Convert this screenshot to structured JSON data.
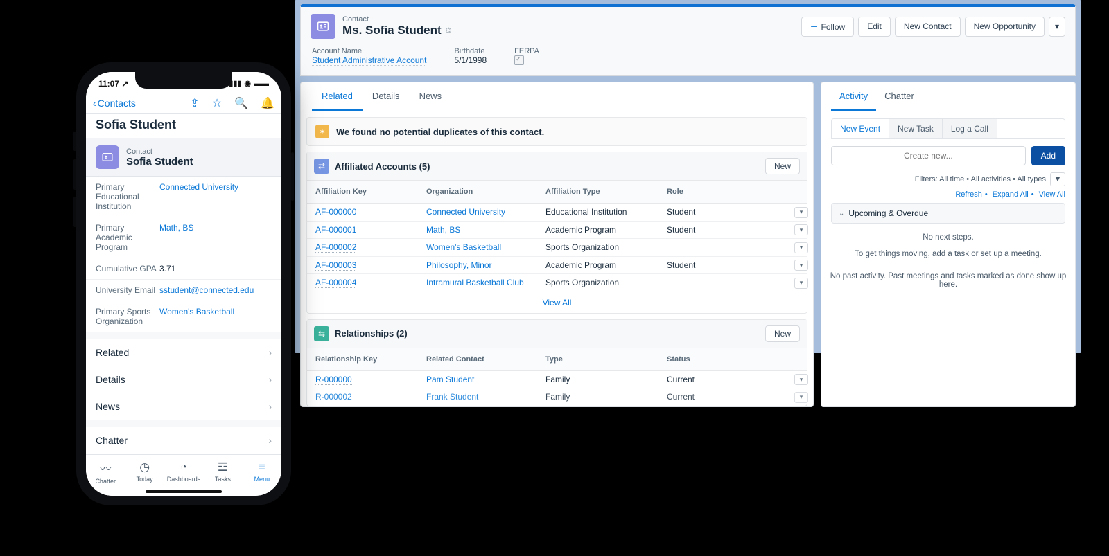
{
  "desktop": {
    "record_type": "Contact",
    "name": "Ms. Sofia Student",
    "actions": {
      "follow": "Follow",
      "edit": "Edit",
      "new_contact": "New Contact",
      "new_opportunity": "New Opportunity"
    },
    "fields": {
      "account_label": "Account Name",
      "account_value": "Student Administrative Account",
      "birth_label": "Birthdate",
      "birth_value": "5/1/1998",
      "ferpa_label": "FERPA"
    },
    "tabs": [
      "Related",
      "Details",
      "News"
    ],
    "duplicate_msg": "We found no potential duplicates of this contact.",
    "affiliated": {
      "title": "Affiliated Accounts (5)",
      "new": "New",
      "cols": [
        "Affiliation Key",
        "Organization",
        "Affiliation Type",
        "Role"
      ],
      "rows": [
        {
          "key": "AF-000000",
          "org": "Connected University",
          "type": "Educational Institution",
          "role": "Student"
        },
        {
          "key": "AF-000001",
          "org": "Math, BS",
          "type": "Academic Program",
          "role": "Student"
        },
        {
          "key": "AF-000002",
          "org": "Women's Basketball",
          "type": "Sports Organization",
          "role": ""
        },
        {
          "key": "AF-000003",
          "org": "Philosophy, Minor",
          "type": "Academic Program",
          "role": "Student"
        },
        {
          "key": "AF-000004",
          "org": "Intramural Basketball Club",
          "type": "Sports Organization",
          "role": ""
        }
      ],
      "view_all": "View All"
    },
    "relationships": {
      "title": "Relationships (2)",
      "new": "New",
      "cols": [
        "Relationship Key",
        "Related Contact",
        "Type",
        "Status"
      ],
      "rows": [
        {
          "key": "R-000000",
          "contact": "Pam Student",
          "type": "Family",
          "status": "Current"
        },
        {
          "key": "R-000002",
          "contact": "Frank Student",
          "type": "Family",
          "status": "Current"
        }
      ]
    }
  },
  "right": {
    "tabs": [
      "Activity",
      "Chatter"
    ],
    "sub_tabs": [
      "New Event",
      "New Task",
      "Log a Call"
    ],
    "create_placeholder": "Create new...",
    "add": "Add",
    "filter_text": "Filters: All time • All activities • All types",
    "refresh": "Refresh",
    "expand": "Expand All",
    "view_all": "View All",
    "upcoming": "Upcoming & Overdue",
    "empty1": "No next steps.",
    "empty2": "To get things moving, add a task or set up a meeting.",
    "past": "No past activity. Past meetings and tasks marked as done show up here."
  },
  "phone": {
    "time": "11:07",
    "back": "Contacts",
    "title": "Sofia Student",
    "card_type": "Contact",
    "card_name": "Sofia Student",
    "fields": [
      {
        "label": "Primary Educational Institution",
        "value": "Connected University",
        "link": true
      },
      {
        "label": "Primary Academic Program",
        "value": "Math, BS",
        "link": true
      },
      {
        "label": "Cumulative GPA",
        "value": "3.71",
        "link": false
      },
      {
        "label": "University Email",
        "value": "sstudent@connected.edu",
        "link": true
      },
      {
        "label": "Primary Sports Organization",
        "value": "Women's Basketball",
        "link": true
      }
    ],
    "sections": [
      "Related",
      "Details",
      "News",
      "Chatter"
    ],
    "tabbar": [
      {
        "icon": "⟿",
        "label": "Chatter"
      },
      {
        "icon": "◷",
        "label": "Today"
      },
      {
        "icon": "◔",
        "label": "Dashboards"
      },
      {
        "icon": "☰",
        "label": "Tasks"
      },
      {
        "icon": "≡",
        "label": "Menu"
      }
    ]
  }
}
